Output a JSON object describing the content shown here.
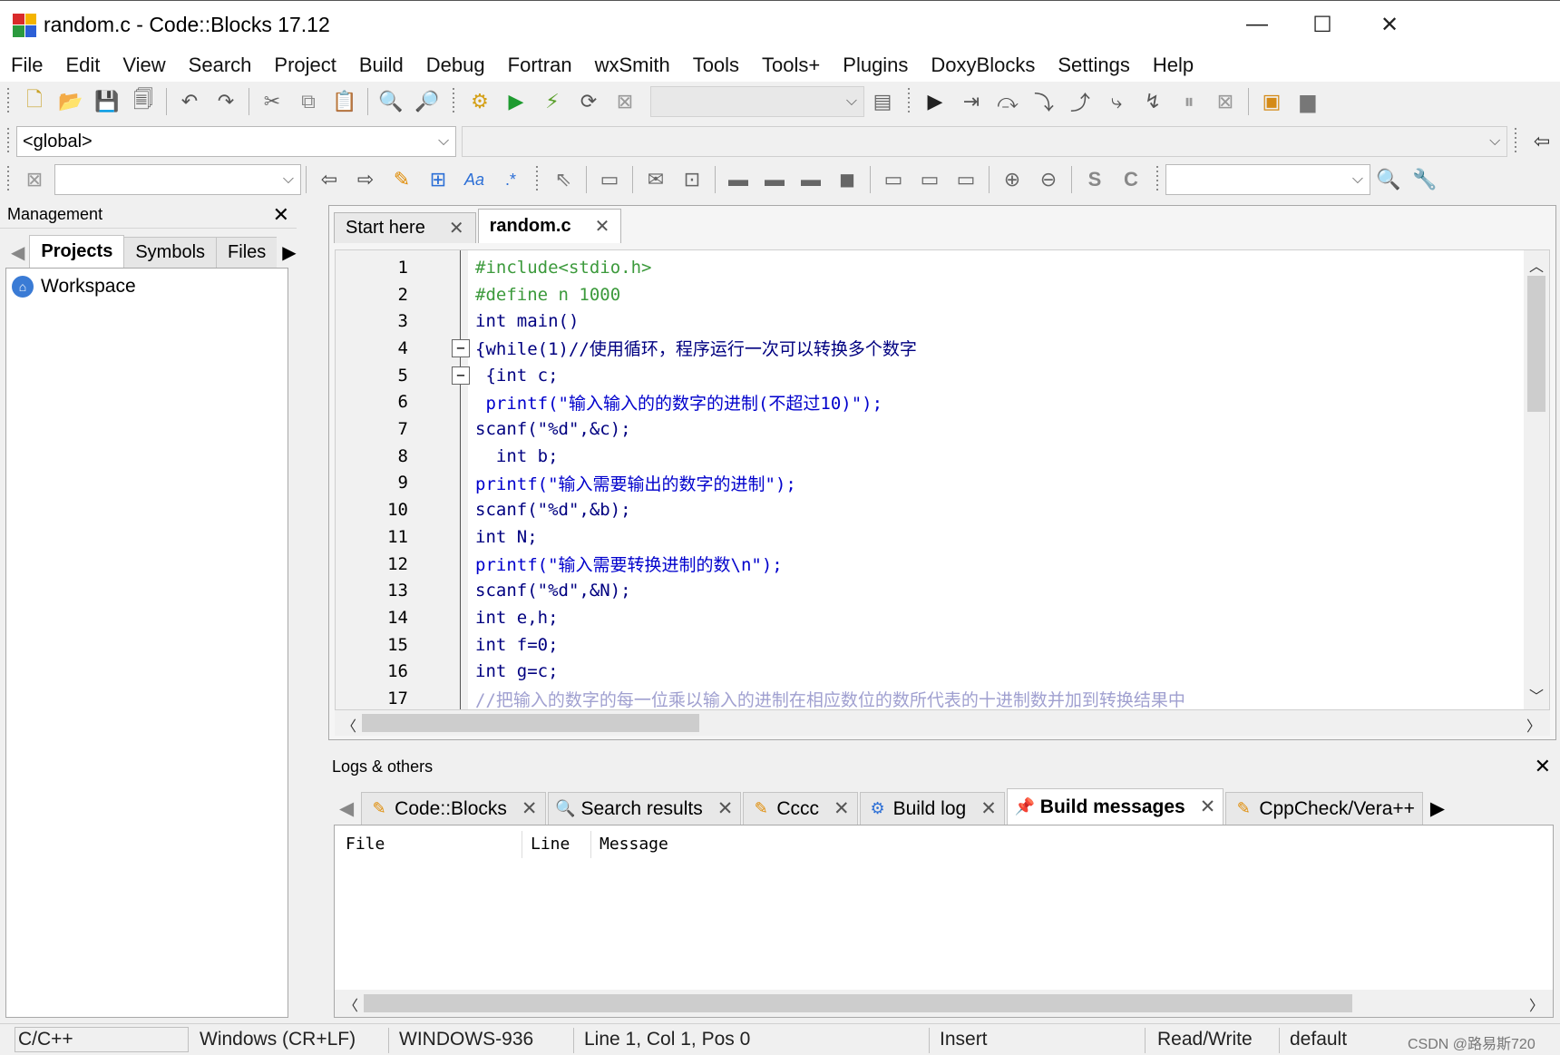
{
  "window": {
    "title": "random.c - Code::Blocks 17.12",
    "minimize": "—",
    "maximize": "☐",
    "close": "✕"
  },
  "menu": [
    "File",
    "Edit",
    "View",
    "Search",
    "Project",
    "Build",
    "Debug",
    "Fortran",
    "wxSmith",
    "Tools",
    "Tools+",
    "Plugins",
    "DoxyBlocks",
    "Settings",
    "Help"
  ],
  "toolbar2": {
    "scope": "<global>"
  },
  "management": {
    "title": "Management",
    "tabs": [
      "Projects",
      "Symbols",
      "Files"
    ],
    "active_tab": "Projects",
    "tree_root": "Workspace"
  },
  "editor": {
    "tabs": [
      {
        "label": "Start here"
      },
      {
        "label": "random.c"
      }
    ],
    "active_tab": "random.c",
    "lines": [
      {
        "n": "1",
        "text": "#include<stdio.h>",
        "color": "#3c9a3c"
      },
      {
        "n": "2",
        "text": "#define n 1000",
        "color": "#3c9a3c"
      },
      {
        "n": "3",
        "text": "int main()",
        "color": "#000080"
      },
      {
        "n": "4",
        "text": "{while(1)//使用循环，程序运行一次可以转换多个数字",
        "color": "#000080"
      },
      {
        "n": "5",
        "text": " {int c;",
        "color": "#000080"
      },
      {
        "n": "6",
        "text": " printf(\"输入输入的的数字的进制(不超过10)\");",
        "color": "#0000cc"
      },
      {
        "n": "7",
        "text": "scanf(\"%d\",&c);",
        "color": "#000080"
      },
      {
        "n": "8",
        "text": "  int b;",
        "color": "#000080"
      },
      {
        "n": "9",
        "text": "printf(\"输入需要输出的数字的进制\");",
        "color": "#0000cc"
      },
      {
        "n": "10",
        "text": "scanf(\"%d\",&b);",
        "color": "#000080"
      },
      {
        "n": "11",
        "text": "int N;",
        "color": "#000080"
      },
      {
        "n": "12",
        "text": "printf(\"输入需要转换进制的数\\n\");",
        "color": "#0000cc"
      },
      {
        "n": "13",
        "text": "scanf(\"%d\",&N);",
        "color": "#000080"
      },
      {
        "n": "14",
        "text": "int e,h;",
        "color": "#000080"
      },
      {
        "n": "15",
        "text": "int f=0;",
        "color": "#000080"
      },
      {
        "n": "16",
        "text": "int g=c;",
        "color": "#000080"
      },
      {
        "n": "17",
        "text": "//把输入的数字的每一位乘以输入的进制在相应数位的数所代表的十进制数并加到转换结果中",
        "color": "#a0a0d0"
      }
    ]
  },
  "logs": {
    "title": "Logs & others",
    "tabs": [
      {
        "label": "Code::Blocks",
        "icon": "pencil-icon"
      },
      {
        "label": "Search results",
        "icon": "search-icon"
      },
      {
        "label": "Cccc",
        "icon": "pencil-icon"
      },
      {
        "label": "Build log",
        "icon": "gear-icon"
      },
      {
        "label": "Build messages",
        "icon": "pin-icon"
      },
      {
        "label": "CppCheck/Vera++",
        "icon": "pencil-icon"
      }
    ],
    "active_tab": "Build messages",
    "columns": [
      "File",
      "Line",
      "Message"
    ]
  },
  "status": {
    "lang": "C/C++",
    "eol": "Windows (CR+LF)",
    "encoding": "WINDOWS-936",
    "position": "Line 1, Col 1, Pos 0",
    "mode": "Insert",
    "access": "Read/Write",
    "profile": "default"
  },
  "watermark": "CSDN @路易斯720"
}
